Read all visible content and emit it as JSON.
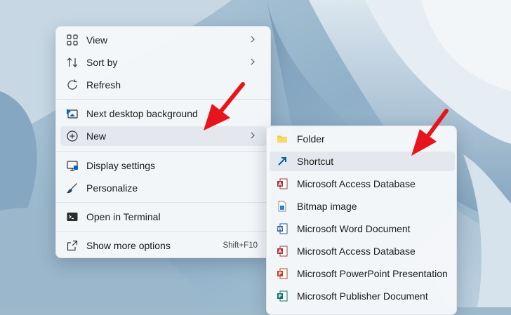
{
  "main_menu": {
    "items": [
      {
        "label": "View",
        "icon": "grid-icon",
        "submenu": true
      },
      {
        "label": "Sort by",
        "icon": "sort-icon",
        "submenu": true
      },
      {
        "label": "Refresh",
        "icon": "refresh-icon"
      },
      {
        "label": "Next desktop background",
        "icon": "next-background-icon"
      },
      {
        "label": "New",
        "icon": "new-icon",
        "submenu": true,
        "highlighted": true
      },
      {
        "label": "Display settings",
        "icon": "display-icon"
      },
      {
        "label": "Personalize",
        "icon": "brush-icon"
      },
      {
        "label": "Open in Terminal",
        "icon": "terminal-icon"
      },
      {
        "label": "Show more options",
        "icon": "share-icon",
        "shortcut": "Shift+F10"
      }
    ]
  },
  "new_submenu": {
    "items": [
      {
        "label": "Folder",
        "icon": "folder-icon"
      },
      {
        "label": "Shortcut",
        "icon": "shortcut-icon",
        "highlighted": true
      },
      {
        "label": "Microsoft Access Database",
        "icon": "access-icon"
      },
      {
        "label": "Bitmap image",
        "icon": "bitmap-icon"
      },
      {
        "label": "Microsoft Word Document",
        "icon": "word-icon"
      },
      {
        "label": "Microsoft Access Database",
        "icon": "access-icon"
      },
      {
        "label": "Microsoft PowerPoint Presentation",
        "icon": "powerpoint-icon"
      },
      {
        "label": "Microsoft Publisher Document",
        "icon": "publisher-icon"
      }
    ]
  },
  "annotations": {
    "arrow_color": "#e8141b",
    "arrow_count": 2
  },
  "colors": {
    "menu_bg": "#f6f8fa",
    "highlight": "#e4e8ee",
    "accent": "#0067c0"
  }
}
